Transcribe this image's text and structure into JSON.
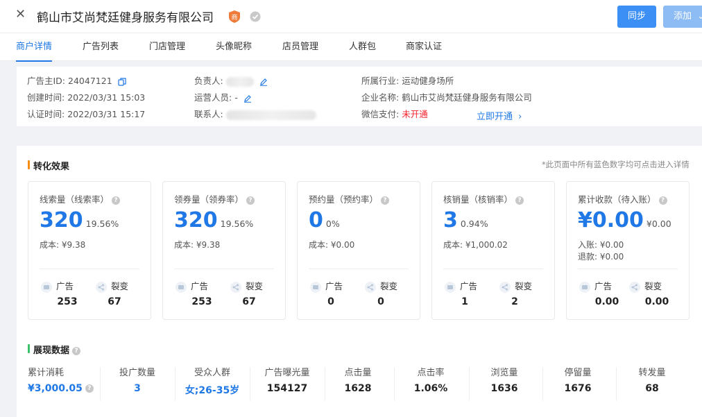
{
  "header": {
    "company_name": "鹤山市艾尚梵廷健身服务有限公司",
    "shop_badge_char": "商",
    "sync_label": "同步",
    "add_label": "添加",
    "accent": "#3c8ff5"
  },
  "tabs": [
    "商户详情",
    "广告列表",
    "门店管理",
    "头像昵称",
    "店员管理",
    "人群包",
    "商家认证"
  ],
  "info": {
    "advertiser_id_label": "广告主ID:",
    "advertiser_id": "24047121",
    "created_label": "创建时间:",
    "created": "2022/03/31 15:03",
    "certified_label": "认证时间:",
    "certified": "2022/03/31 15:17",
    "owner_label": "负责人:",
    "operator_label": "运营人员:",
    "operator": "-",
    "contact_label": "联系人:",
    "industry_label": "所属行业:",
    "industry": "运动健身场所",
    "company_label": "企业名称:",
    "company": "鹤山市艾尚梵廷健身服务有限公司",
    "wechat_pay_label": "微信支付:",
    "wechat_pay_status": "未开通",
    "open_now": "立即开通"
  },
  "conversion": {
    "title": "转化效果",
    "note": "*此页面中所有蓝色数字均可点击进入详情",
    "cards": [
      {
        "label": "线索量（线索率）",
        "big": "320",
        "rate": "19.56%",
        "sub1": "成本: ¥9.38",
        "sub2": "",
        "ad_label": "广告",
        "ad": "253",
        "viral_label": "裂变",
        "viral": "67"
      },
      {
        "label": "领券量（领券率）",
        "big": "320",
        "rate": "19.56%",
        "sub1": "成本: ¥9.38",
        "sub2": "",
        "ad_label": "广告",
        "ad": "253",
        "viral_label": "裂变",
        "viral": "67"
      },
      {
        "label": "预约量（预约率）",
        "big": "0",
        "rate": "0%",
        "sub1": "成本: ¥0.00",
        "sub2": "",
        "ad_label": "广告",
        "ad": "0",
        "viral_label": "裂变",
        "viral": "0"
      },
      {
        "label": "核销量（核销率）",
        "big": "3",
        "rate": "0.94%",
        "sub1": "成本: ¥1,000.02",
        "sub2": "",
        "ad_label": "广告",
        "ad": "1",
        "viral_label": "裂变",
        "viral": "2"
      },
      {
        "label": "累计收款（待入账）",
        "big": "¥0.00",
        "rate": "¥0.00",
        "sub1": "入账: ¥0.00",
        "sub2": "退款: ¥0.00",
        "ad_label": "广告",
        "ad": "0.00",
        "viral_label": "裂变",
        "viral": "0.00"
      }
    ]
  },
  "display": {
    "title": "展现数据",
    "stats": [
      {
        "label": "累计消耗",
        "value": "¥3,000.05"
      },
      {
        "label": "投广数量",
        "value": "3"
      },
      {
        "label": "受众人群",
        "value": "女;26-35岁"
      },
      {
        "label": "广告曝光量",
        "value": "154127"
      },
      {
        "label": "点击量",
        "value": "1628"
      },
      {
        "label": "点击率",
        "value": "1.06%"
      },
      {
        "label": "浏览量",
        "value": "1636"
      },
      {
        "label": "停留量",
        "value": "1676"
      },
      {
        "label": "转发量",
        "value": "68"
      }
    ]
  }
}
